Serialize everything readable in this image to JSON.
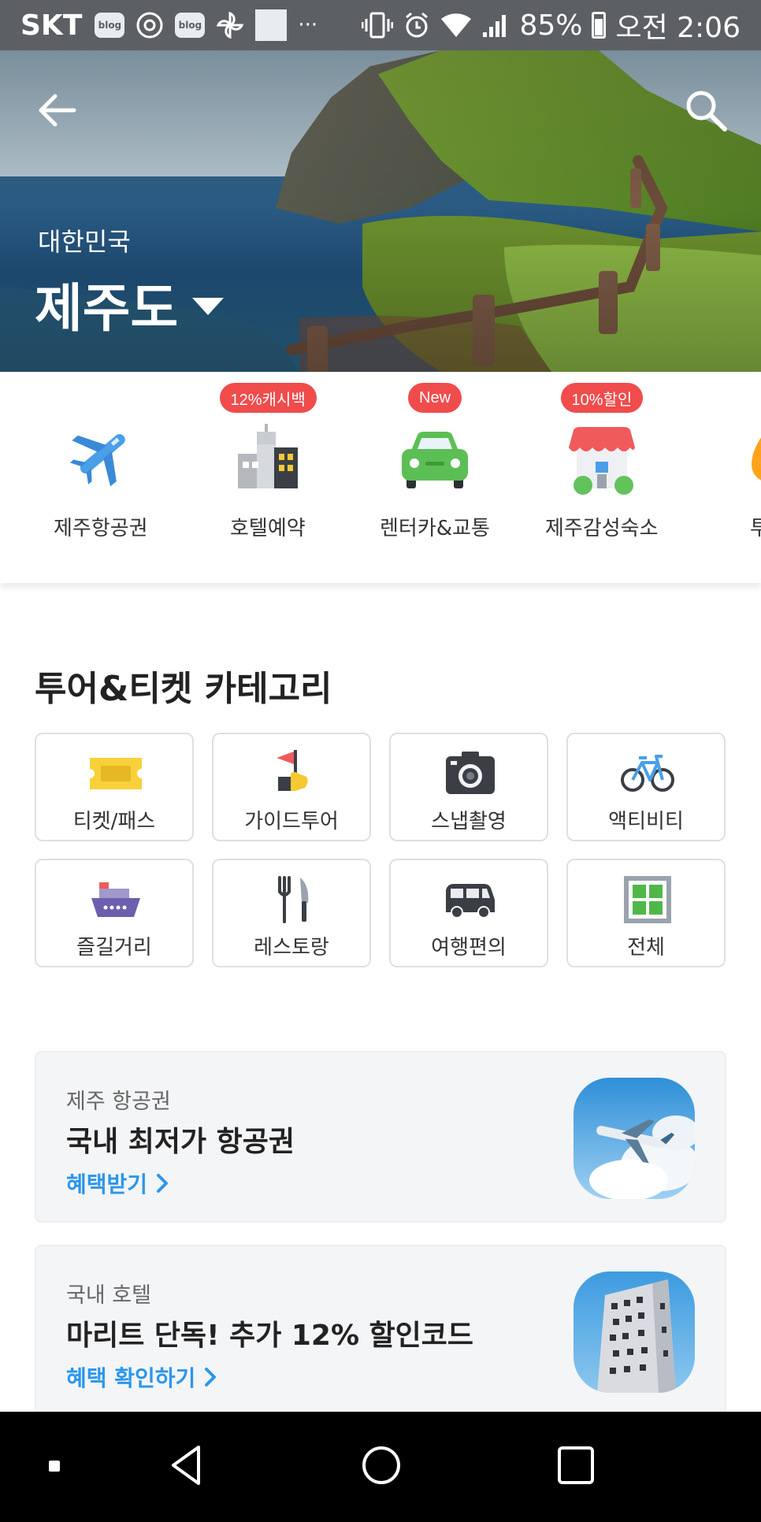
{
  "status_bar": {
    "carrier": "SKT",
    "blog_badge": "blog",
    "more": "···",
    "battery": "85%",
    "time": "오전 2:06"
  },
  "hero": {
    "country": "대한민국",
    "region": "제주도"
  },
  "quick_categories": [
    {
      "label": "제주항공권",
      "badge": "",
      "icon": "airplane-icon"
    },
    {
      "label": "호텔예약",
      "badge": "12%캐시백",
      "icon": "hotel-building-icon"
    },
    {
      "label": "렌터카&교통",
      "badge": "New",
      "icon": "car-icon"
    },
    {
      "label": "제주감성숙소",
      "badge": "10%할인",
      "icon": "house-icon"
    },
    {
      "label": "투어",
      "badge": "",
      "icon": "tour-icon"
    }
  ],
  "tour_category": {
    "title": "투어&티켓 카테고리",
    "tiles": [
      {
        "label": "티켓/패스",
        "icon": "ticket-icon"
      },
      {
        "label": "가이드투어",
        "icon": "flag-guide-icon"
      },
      {
        "label": "스냅촬영",
        "icon": "camera-icon"
      },
      {
        "label": "액티비티",
        "icon": "bicycle-icon"
      },
      {
        "label": "즐길거리",
        "icon": "ship-icon"
      },
      {
        "label": "레스토랑",
        "icon": "fork-knife-icon"
      },
      {
        "label": "여행편의",
        "icon": "van-icon"
      },
      {
        "label": "전체",
        "icon": "grid-icon"
      }
    ]
  },
  "promos": [
    {
      "subtitle": "제주 항공권",
      "title": "국내 최저가 항공권",
      "link": "혜택받기",
      "image": "airplane-sky-image"
    },
    {
      "subtitle": "국내 호텔",
      "title": "마리트 단독! 추가 12% 할인코드",
      "link": "혜택 확인하기",
      "image": "hotel-building-image"
    }
  ],
  "colors": {
    "accent_blue": "#2b96ed",
    "badge_red": "#f04c4c",
    "status_bar": "#5c6064"
  }
}
